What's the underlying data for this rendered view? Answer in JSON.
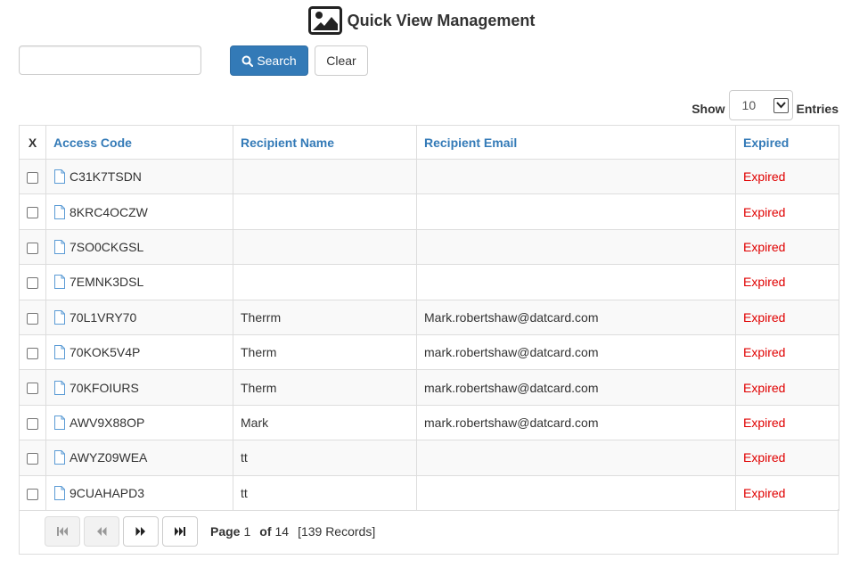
{
  "header": {
    "title": "Quick View Management",
    "icon": "image-icon"
  },
  "search": {
    "value": "",
    "placeholder": "",
    "search_label": "Search",
    "clear_label": "Clear"
  },
  "entries": {
    "show_label": "Show",
    "value": "10",
    "entries_label": "Entries"
  },
  "table": {
    "columns": {
      "x": "X",
      "access_code": "Access Code",
      "recipient_name": "Recipient Name",
      "recipient_email": "Recipient Email",
      "expired": "Expired"
    },
    "rows": [
      {
        "code": "C31K7TSDN",
        "name": "",
        "email": "",
        "status": "Expired"
      },
      {
        "code": "8KRC4OCZW",
        "name": "",
        "email": "",
        "status": "Expired"
      },
      {
        "code": "7SO0CKGSL",
        "name": "",
        "email": "",
        "status": "Expired"
      },
      {
        "code": "7EMNK3DSL",
        "name": "",
        "email": "",
        "status": "Expired"
      },
      {
        "code": "70L1VRY70",
        "name": "Therrm",
        "email": "Mark.robertshaw@datcard.com",
        "status": "Expired"
      },
      {
        "code": "70KOK5V4P",
        "name": "Therm",
        "email": "mark.robertshaw@datcard.com",
        "status": "Expired"
      },
      {
        "code": "70KFOIURS",
        "name": "Therm",
        "email": "mark.robertshaw@datcard.com",
        "status": "Expired"
      },
      {
        "code": "AWV9X88OP",
        "name": "Mark",
        "email": "mark.robertshaw@datcard.com",
        "status": "Expired"
      },
      {
        "code": "AWYZ09WEA",
        "name": "tt",
        "email": "",
        "status": "Expired"
      },
      {
        "code": "9CUAHAPD3",
        "name": "tt",
        "email": "",
        "status": "Expired"
      }
    ]
  },
  "pager": {
    "page_label": "Page",
    "current": "1",
    "of_label": "of",
    "total": "14",
    "records": "[139 Records]"
  },
  "colors": {
    "accent": "#337ab7",
    "expired": "#e00000"
  }
}
